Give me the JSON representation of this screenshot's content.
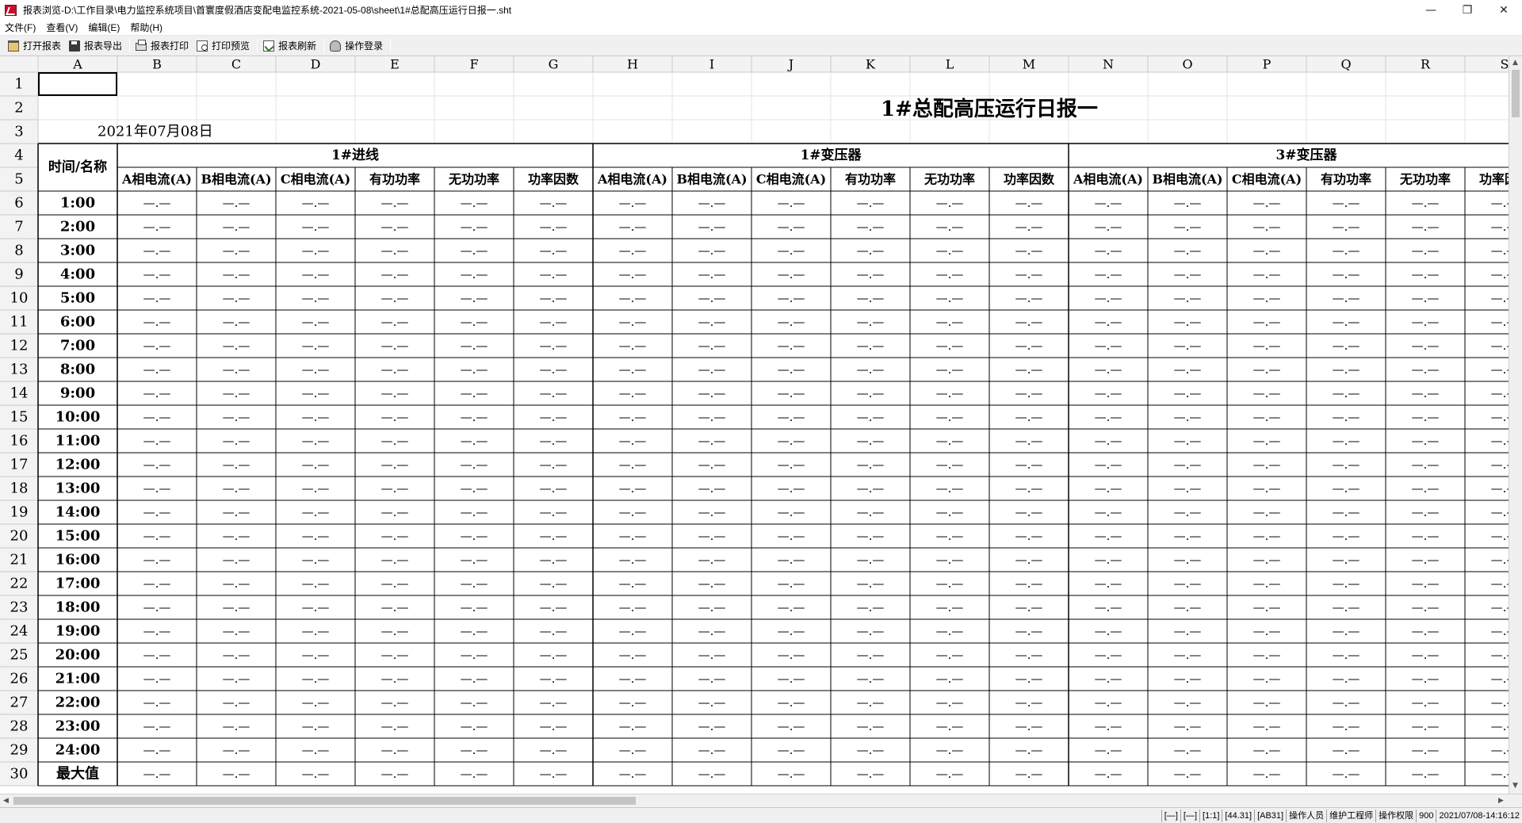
{
  "window": {
    "title": "报表浏览-D:\\工作目录\\电力监控系统项目\\首寰度假酒店变配电监控系统-2021-05-08\\sheet\\1#总配高压运行日报一.sht",
    "minimize": "—",
    "restore": "❐",
    "close": "✕"
  },
  "menu": [
    "文件(F)",
    "查看(V)",
    "编辑(E)",
    "帮助(H)"
  ],
  "toolbar": [
    {
      "label": "打开报表",
      "icon": "open-icon"
    },
    {
      "label": "报表导出",
      "icon": "save-icon"
    },
    {
      "label": "报表打印",
      "icon": "print-icon"
    },
    {
      "label": "打印预览",
      "icon": "preview-icon"
    },
    {
      "label": "报表刷新",
      "icon": "refresh-icon"
    },
    {
      "label": "操作登录",
      "icon": "login-icon"
    }
  ],
  "sheet": {
    "columns": [
      "A",
      "B",
      "C",
      "D",
      "E",
      "F",
      "G",
      "H",
      "I",
      "J",
      "K",
      "L",
      "M",
      "N",
      "O",
      "P",
      "Q",
      "R",
      "S"
    ],
    "rows": [
      "1",
      "2",
      "3",
      "4",
      "5",
      "6",
      "7",
      "8",
      "9",
      "10",
      "11",
      "12",
      "13",
      "14",
      "15",
      "16",
      "17",
      "18",
      "19",
      "20",
      "21",
      "22",
      "23",
      "24",
      "25",
      "26",
      "27",
      "28",
      "29",
      "30"
    ],
    "report_title": "1#总配高压运行日报一",
    "date": "2021年07月08日",
    "name_header": "时间/名称",
    "groups": [
      "1#进线",
      "1#变压器",
      "3#变压器"
    ],
    "sub_headers": [
      "A相电流(A)",
      "B相电流(A)",
      "C相电流(A)",
      "有功功率",
      "无功功率",
      "功率因数"
    ],
    "times": [
      "1:00",
      "2:00",
      "3:00",
      "4:00",
      "5:00",
      "6:00",
      "7:00",
      "8:00",
      "9:00",
      "10:00",
      "11:00",
      "12:00",
      "13:00",
      "14:00",
      "15:00",
      "16:00",
      "17:00",
      "18:00",
      "19:00",
      "20:00",
      "21:00",
      "22:00",
      "23:00",
      "24:00",
      "最大值"
    ],
    "empty_value": "—.—"
  },
  "status": [
    "[—]",
    "[—]",
    "[1:1]",
    "[44.31]",
    "[AB31]",
    "操作人员",
    "维护工程师",
    "操作权限",
    "900",
    "2021/07/08-14:16:12"
  ],
  "scroll": {
    "left": "◀",
    "right": "▶",
    "up": "▲",
    "down": "▼"
  }
}
